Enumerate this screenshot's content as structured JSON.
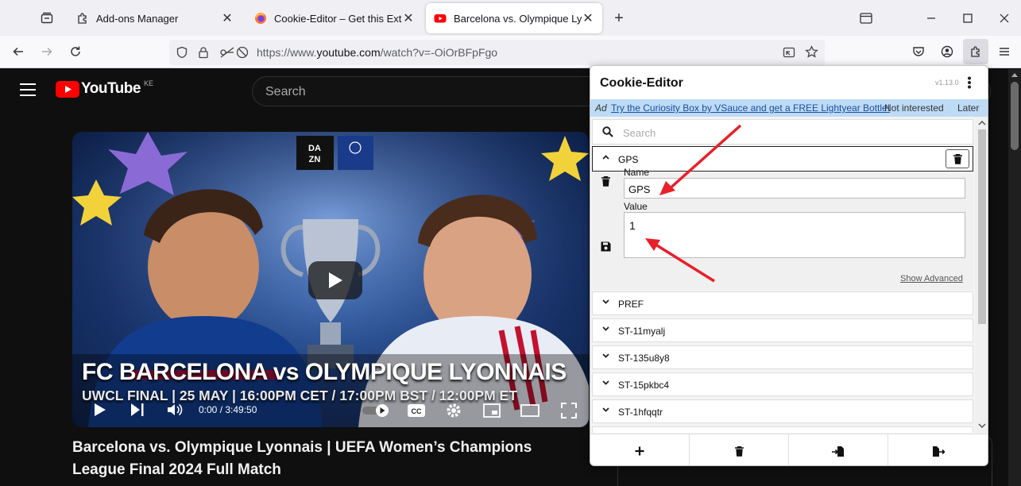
{
  "browser": {
    "tabs": [
      {
        "title": "Add-ons Manager",
        "active": false
      },
      {
        "title": "Cookie-Editor – Get this Extensi",
        "active": false
      },
      {
        "title": "Barcelona vs. Olympique Lyonn",
        "active": true
      }
    ],
    "url_prefix": "https://www.",
    "url_domain": "youtube.com",
    "url_path": "/watch?v=-OiOrBFpFgo"
  },
  "youtube": {
    "logo_text": "YouTube",
    "region": "KE",
    "search_placeholder": "Search",
    "video": {
      "thumb_title": "FC BARCELONA vs OLYMPIQUE LYONNAIS",
      "thumb_subtitle": "UWCL FINAL | 25 MAY | 16:00PM CET / 17:00PM BST / 12:00PM ET",
      "time": "0:00 / 3:49:50",
      "title": "Barcelona vs. Olympique Lyonnais | UEFA Women’s Champions League Final 2024 Full Match"
    }
  },
  "cookie_editor": {
    "title": "Cookie-Editor",
    "version": "v1.13.0",
    "ad": {
      "label": "Ad",
      "link": "Try the Curiosity Box by VSauce and get a FREE Lightyear Bottle!",
      "not_interested": "Not interested",
      "later": "Later"
    },
    "search_placeholder": "Search",
    "expanded_cookie": {
      "name": "GPS",
      "name_label": "Name",
      "name_value": "GPS",
      "value_label": "Value",
      "value_value": "1",
      "show_advanced": "Show Advanced"
    },
    "cookies": [
      "PREF",
      "ST-11myalj",
      "ST-135u8y8",
      "ST-15pkbc4",
      "ST-1hfqqtr"
    ]
  },
  "colors": {
    "annotation_arrow": "#e8202a",
    "youtube_red": "#ff0000",
    "ad_bar": "#bddbf5"
  }
}
